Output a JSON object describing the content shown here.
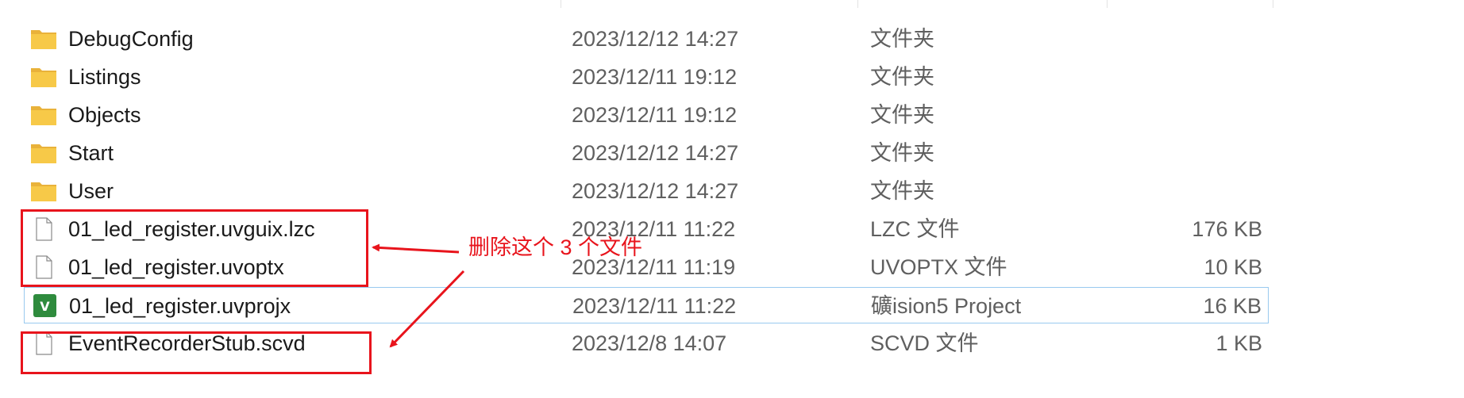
{
  "files": [
    {
      "name": "DebugConfig",
      "date": "2023/12/12 14:27",
      "type": "文件夹",
      "size": "",
      "icon": "folder-icon"
    },
    {
      "name": "Listings",
      "date": "2023/12/11 19:12",
      "type": "文件夹",
      "size": "",
      "icon": "folder-icon"
    },
    {
      "name": "Objects",
      "date": "2023/12/11 19:12",
      "type": "文件夹",
      "size": "",
      "icon": "folder-icon"
    },
    {
      "name": "Start",
      "date": "2023/12/12 14:27",
      "type": "文件夹",
      "size": "",
      "icon": "folder-icon"
    },
    {
      "name": "User",
      "date": "2023/12/12 14:27",
      "type": "文件夹",
      "size": "",
      "icon": "folder-icon"
    },
    {
      "name": "01_led_register.uvguix.lzc",
      "date": "2023/12/11 11:22",
      "type": "LZC 文件",
      "size": "176 KB",
      "icon": "file-icon"
    },
    {
      "name": "01_led_register.uvoptx",
      "date": "2023/12/11 11:19",
      "type": "UVOPTX 文件",
      "size": "10 KB",
      "icon": "file-icon"
    },
    {
      "name": "01_led_register.uvprojx",
      "date": "2023/12/11 11:22",
      "type": "礦ision5 Project",
      "size": "16 KB",
      "icon": "uvision-project-icon"
    },
    {
      "name": "EventRecorderStub.scvd",
      "date": "2023/12/8 14:07",
      "type": "SCVD 文件",
      "size": "1 KB",
      "icon": "file-icon"
    }
  ],
  "annotation": {
    "text": "删除这个 3 个文件",
    "color": "#e8141c"
  },
  "colors": {
    "selection_border": "#99c9ef",
    "folder": "#f7c948",
    "highlight": "#e8141c"
  }
}
